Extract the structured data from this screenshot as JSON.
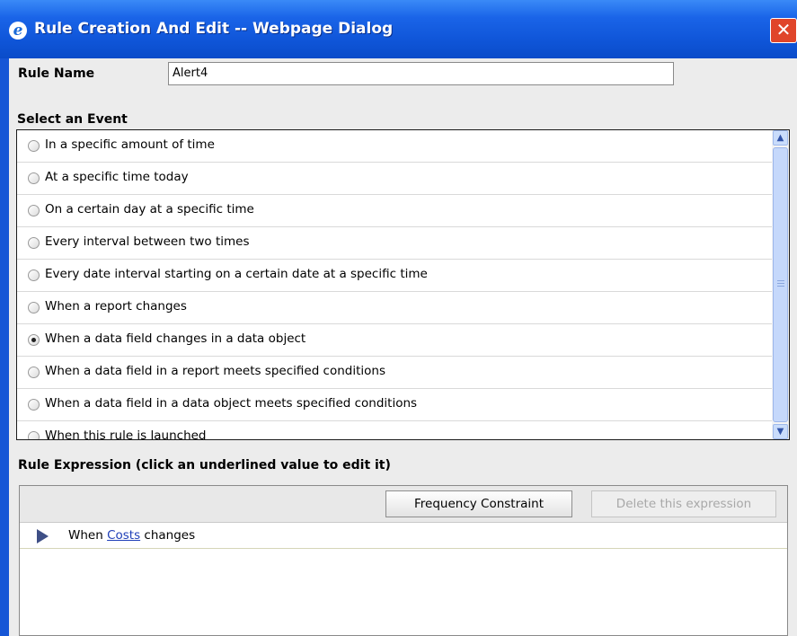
{
  "window": {
    "title": "Rule Creation And Edit -- Webpage Dialog",
    "app_icon": "internet-explorer-icon",
    "close_glyph": "✕"
  },
  "rule_name": {
    "label": "Rule Name",
    "value": "Alert4"
  },
  "events": {
    "label": "Select an Event",
    "items": [
      {
        "label": "In a specific amount of time",
        "selected": false
      },
      {
        "label": "At a specific time today",
        "selected": false
      },
      {
        "label": "On a certain day at a specific time",
        "selected": false
      },
      {
        "label": "Every interval between two times",
        "selected": false
      },
      {
        "label": "Every date interval starting on a certain date at a specific time",
        "selected": false
      },
      {
        "label": "When a report changes",
        "selected": false
      },
      {
        "label": "When a data field changes in a data object",
        "selected": true
      },
      {
        "label": "When a data field in a report meets specified conditions",
        "selected": false
      },
      {
        "label": "When a data field in a data object meets specified conditions",
        "selected": false
      },
      {
        "label": "When this rule is launched",
        "selected": false
      }
    ],
    "scroll_up_glyph": "▲",
    "scroll_down_glyph": "▼"
  },
  "expression": {
    "label": "Rule Expression (click an underlined value to edit it)",
    "frequency_button": "Frequency Constraint",
    "delete_button": "Delete this expression",
    "row": {
      "prefix": "When",
      "link": "Costs",
      "suffix": "changes"
    }
  },
  "colors": {
    "titlebar": "#0a4cc9",
    "close_button": "#e0452a",
    "dialog_bg": "#ececec",
    "link": "#1f3fb8",
    "expand_triangle": "#3e4f86"
  }
}
